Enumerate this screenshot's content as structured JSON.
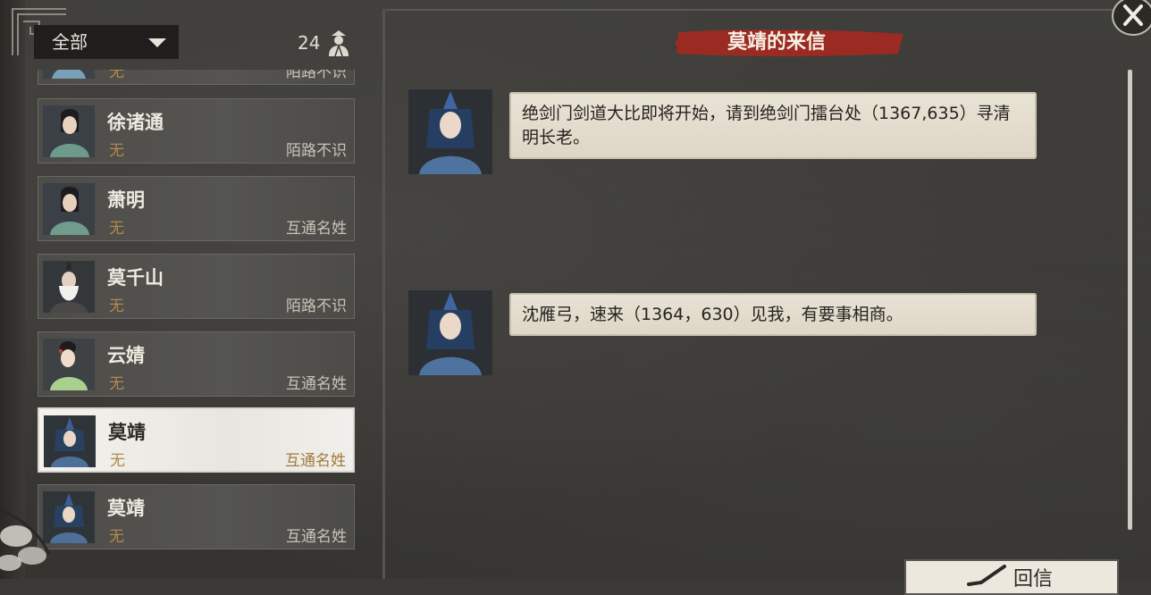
{
  "filter": {
    "label": "全部"
  },
  "friends": {
    "count": "24"
  },
  "contacts": [
    {
      "name": "",
      "status": "无",
      "relation": "陌路不识"
    },
    {
      "name": "徐诸通",
      "status": "无",
      "relation": "陌路不识"
    },
    {
      "name": "萧明",
      "status": "无",
      "relation": "互通名姓"
    },
    {
      "name": "莫千山",
      "status": "无",
      "relation": "陌路不识"
    },
    {
      "name": "云婧",
      "status": "无",
      "relation": "互通名姓"
    },
    {
      "name": "莫靖",
      "status": "无",
      "relation": "互通名姓"
    },
    {
      "name": "莫靖",
      "status": "无",
      "relation": "互通名姓"
    }
  ],
  "letter": {
    "title": "莫靖的来信"
  },
  "messages": [
    {
      "text": "绝剑门剑道大比即将开始，请到绝剑门擂台处（1367,635）寻清明长老。"
    },
    {
      "text": "沈雁弓，速来（1364，630）见我，有要事相商。"
    }
  ],
  "reply": {
    "label": "回信"
  },
  "colors": {
    "accent_red": "#9a2a22",
    "status_gold": "#b28a4a",
    "selected_bg": "#efeee9"
  }
}
